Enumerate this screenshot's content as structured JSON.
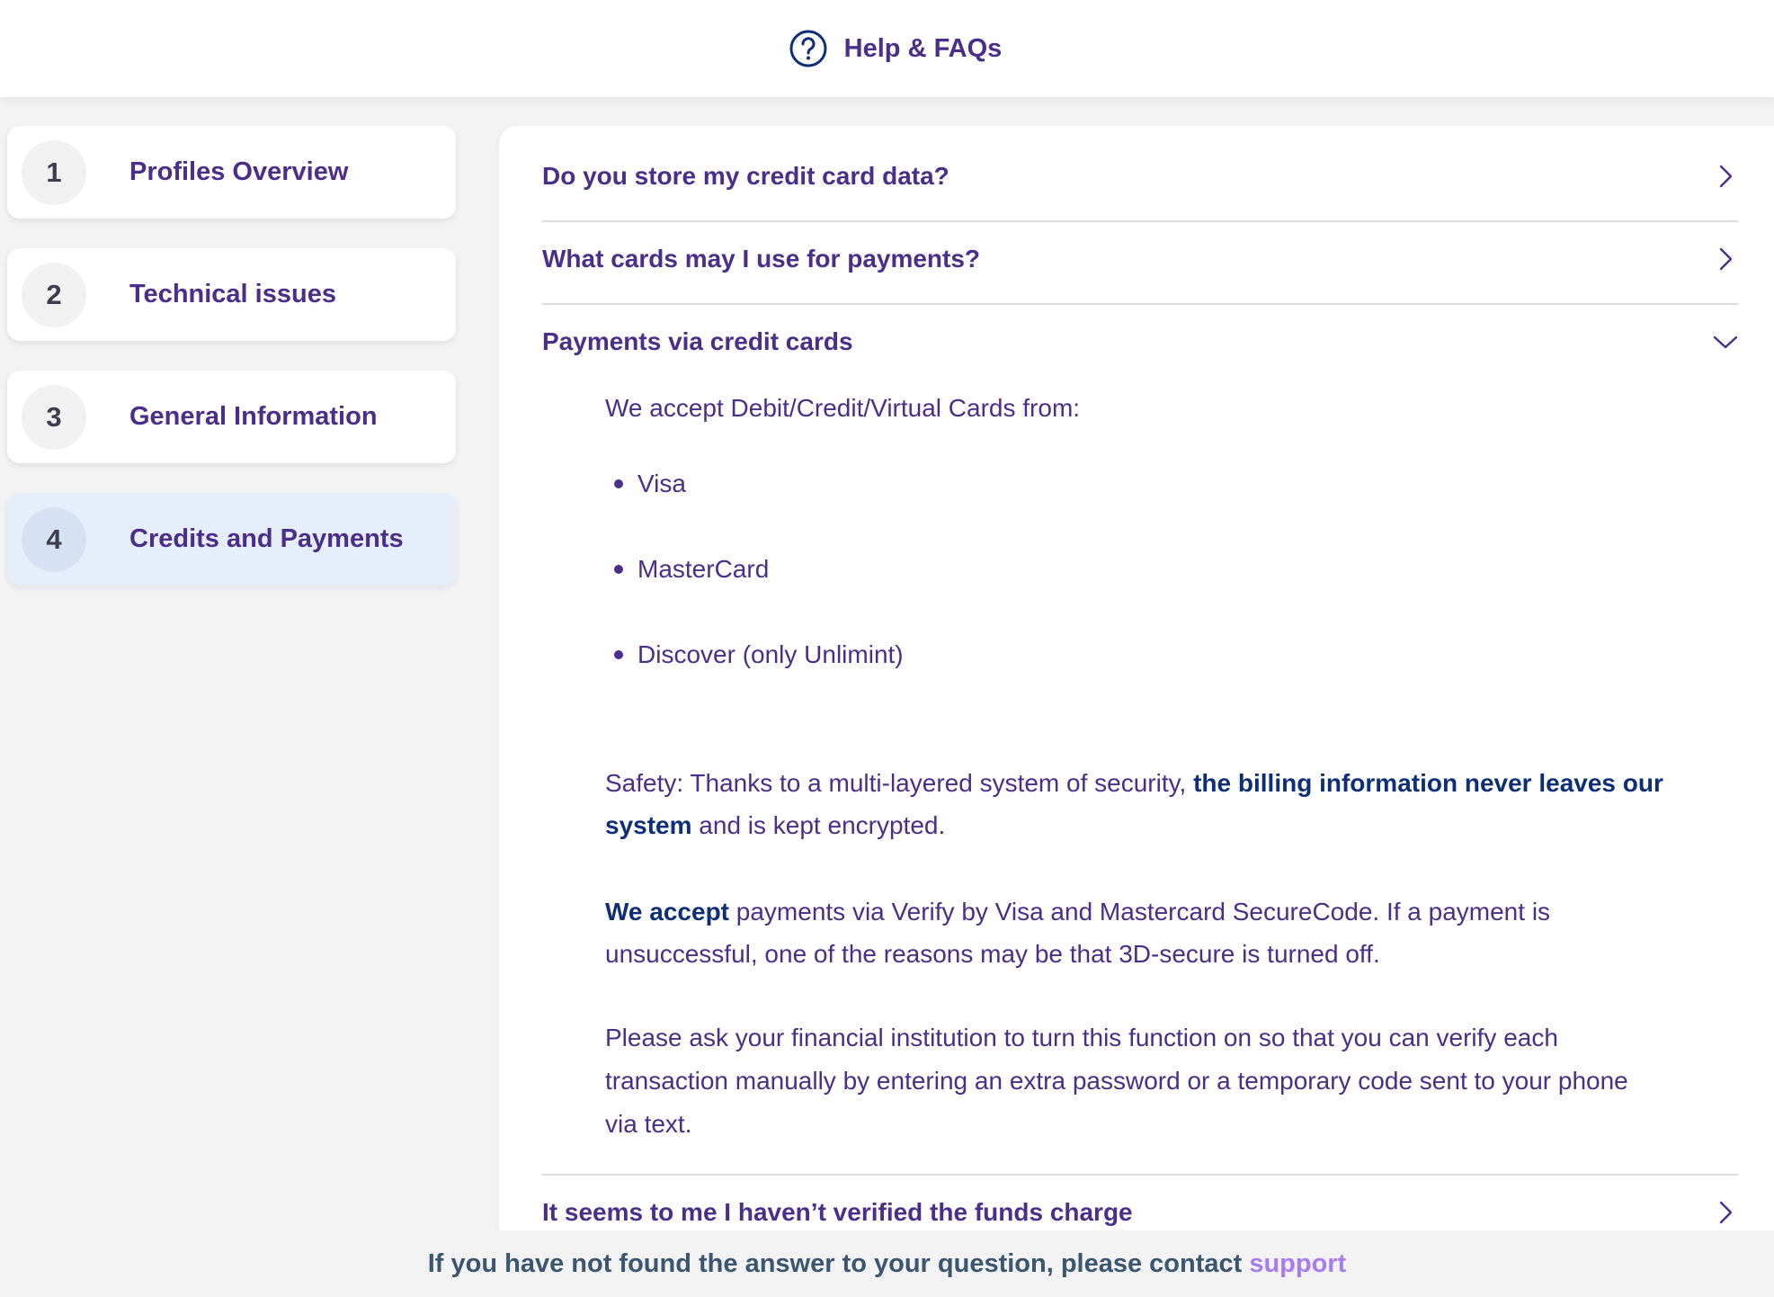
{
  "header": {
    "icon": "question-circle-icon",
    "title": "Help & FAQs"
  },
  "sidebar": {
    "items": [
      {
        "number": "1",
        "label": "Profiles Overview",
        "active": false
      },
      {
        "number": "2",
        "label": "Technical issues",
        "active": false
      },
      {
        "number": "3",
        "label": "General Information",
        "active": false
      },
      {
        "number": "4",
        "label": "Credits and Payments",
        "active": true
      }
    ]
  },
  "faq": {
    "items": [
      {
        "question": "Do you store my credit card data?",
        "expanded": false,
        "icon": "chevron-right-icon"
      },
      {
        "question": "What cards may I use for payments?",
        "expanded": false,
        "icon": "chevron-right-icon"
      },
      {
        "question": "Payments via credit cards",
        "expanded": true,
        "icon": "chevron-down-icon"
      },
      {
        "question": "It seems to me I haven’t verified the funds charge",
        "expanded": false,
        "icon": "chevron-right-icon"
      }
    ],
    "answer": {
      "intro": "We accept Debit/Credit/Virtual Cards from:",
      "cards": [
        "Visa",
        "MasterCard",
        "Discover (only Unlimint)"
      ],
      "safety_prefix": "Safety: Thanks to a multi-layered system of security, ",
      "safety_bold_line1": "the billing information never leaves our",
      "safety_bold_line2": "system",
      "safety_suffix": " and is kept encrypted.",
      "accept_bold": "We accept",
      "accept_line1": " payments via Verify by Visa and Mastercard SecureCode. If a payment is",
      "accept_line2": "unsuccessful, one of the reasons may be that 3D-secure is turned off.",
      "ask_line1": "Please ask your financial institution to turn this function on so that you can verify each",
      "ask_line2": "transaction manually by entering an extra password or a temporary code sent to your phone",
      "ask_line3": "via text."
    }
  },
  "footer": {
    "text": "If you have not found the answer to your question, please contact",
    "link": "support"
  },
  "colors": {
    "primary_text": "#4a2e8a",
    "strong_text": "#0e2f78",
    "link": "#a77cf0",
    "active_bg": "#e6eefb",
    "page_bg": "#f3f3f3"
  }
}
